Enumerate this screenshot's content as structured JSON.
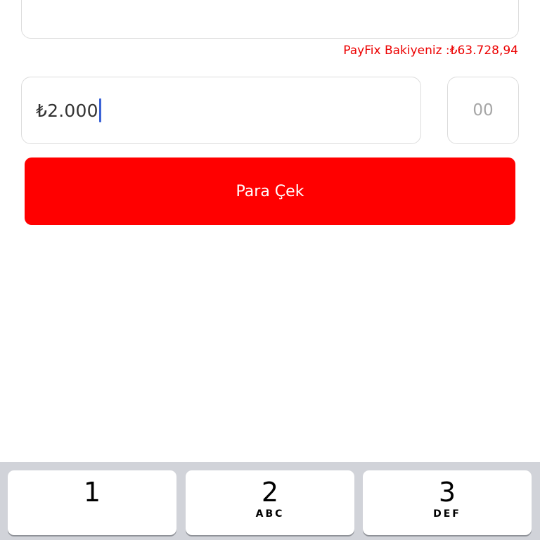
{
  "balance": {
    "text": "PayFix Bakiyeniz :₺63.728,94"
  },
  "amount_input": {
    "value": "₺2.000"
  },
  "cents_input": {
    "placeholder": "00"
  },
  "withdraw_button": {
    "label": "Para Çek"
  },
  "keyboard": {
    "keys": [
      {
        "digit": "1",
        "letters": ""
      },
      {
        "digit": "2",
        "letters": "ABC"
      },
      {
        "digit": "3",
        "letters": "DEF"
      }
    ]
  },
  "colors": {
    "accent": "#ff0000",
    "balance_text": "#ec0000",
    "caret": "#3b63d6"
  }
}
